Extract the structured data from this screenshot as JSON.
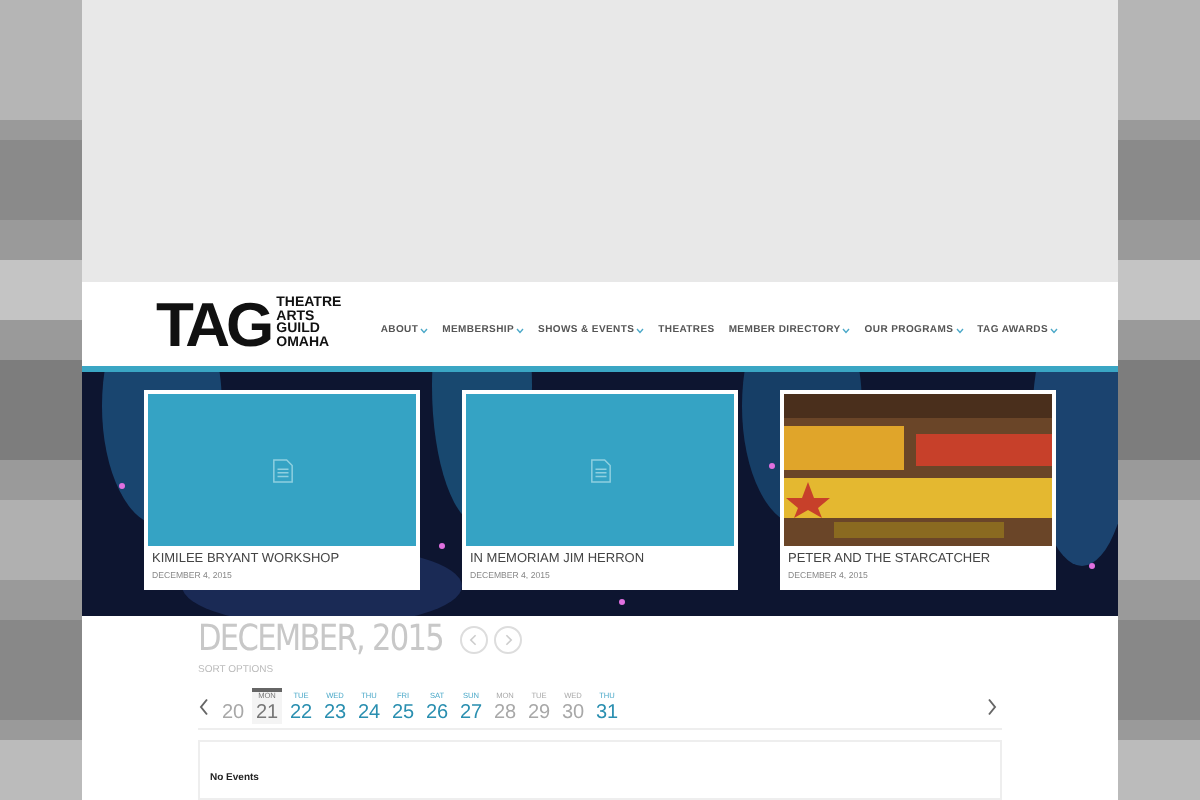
{
  "logo": {
    "mark": "TAG",
    "lines": [
      "THEATRE",
      "ARTS",
      "GUILD",
      "OMAHA"
    ]
  },
  "nav": [
    {
      "label": "ABOUT",
      "dropdown": true
    },
    {
      "label": "MEMBERSHIP",
      "dropdown": true
    },
    {
      "label": "SHOWS & EVENTS",
      "dropdown": true
    },
    {
      "label": "THEATRES",
      "dropdown": false
    },
    {
      "label": "MEMBER DIRECTORY",
      "dropdown": true
    },
    {
      "label": "OUR PROGRAMS",
      "dropdown": true
    },
    {
      "label": "TAG AWARDS",
      "dropdown": true
    }
  ],
  "cards": [
    {
      "kind": "placeholder",
      "title": "KIMILEE BRYANT WORKSHOP",
      "date": "DECEMBER 4, 2015"
    },
    {
      "kind": "placeholder",
      "title": "IN MEMORIAM JIM HERRON",
      "date": "DECEMBER 4, 2015"
    },
    {
      "kind": "picture",
      "title": "PETER AND THE STARCATCHER",
      "date": "DECEMBER 4, 2015"
    }
  ],
  "calendar": {
    "title": "DECEMBER, 2015",
    "sort_label": "SORT OPTIONS",
    "days": [
      {
        "num": "20",
        "selected": false,
        "disabled": true
      },
      {
        "dow": "MON",
        "num": "21",
        "selected": true,
        "disabled": false
      },
      {
        "dow": "TUE",
        "num": "22",
        "selected": false,
        "disabled": false
      },
      {
        "dow": "WED",
        "num": "23",
        "selected": false,
        "disabled": false
      },
      {
        "dow": "THU",
        "num": "24",
        "selected": false,
        "disabled": false
      },
      {
        "dow": "FRI",
        "num": "25",
        "selected": false,
        "disabled": false
      },
      {
        "dow": "SAT",
        "num": "26",
        "selected": false,
        "disabled": false
      },
      {
        "dow": "SUN",
        "num": "27",
        "selected": false,
        "disabled": false
      },
      {
        "dow": "MON",
        "num": "28",
        "selected": false,
        "disabled": true
      },
      {
        "dow": "TUE",
        "num": "29",
        "selected": false,
        "disabled": true
      },
      {
        "dow": "WED",
        "num": "30",
        "selected": false,
        "disabled": true
      },
      {
        "dow": "THU",
        "num": "31",
        "selected": false,
        "disabled": false
      }
    ],
    "empty_text": "No Events"
  }
}
